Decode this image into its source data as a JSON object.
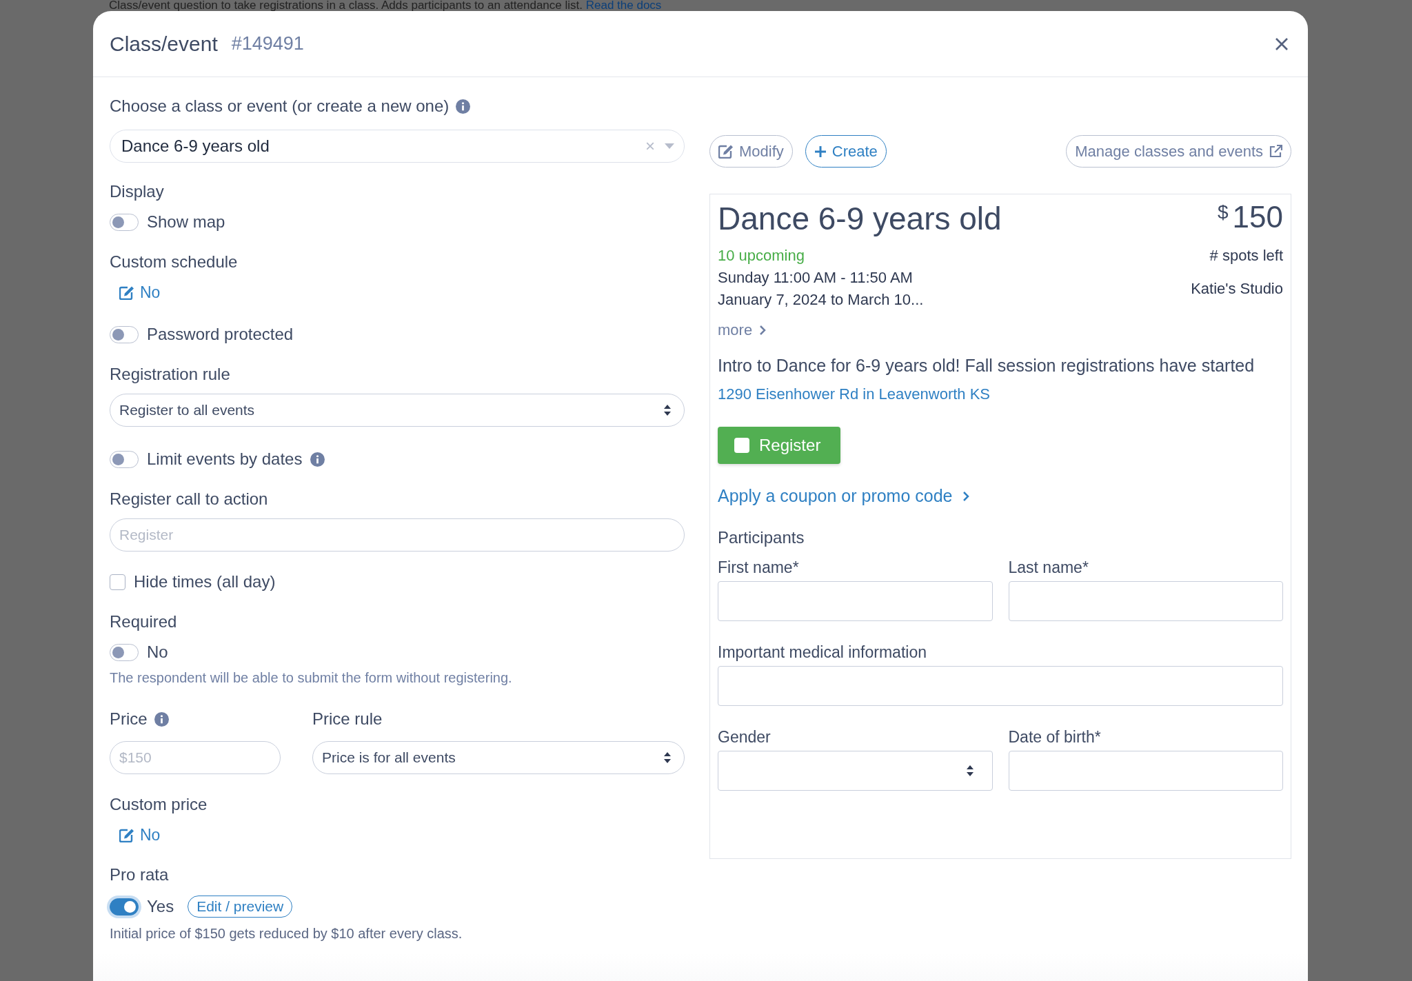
{
  "background": {
    "text": "Class/event question to take registrations in a class. Adds participants to an attendance list.",
    "link": "Read the docs"
  },
  "modal": {
    "title": "Class/event",
    "id": "#149491"
  },
  "chooser": {
    "label": "Choose a class or event (or create a new one)",
    "info": true,
    "value": "Dance 6-9 years old",
    "clear": "×"
  },
  "actions": [
    {
      "label": "Modify"
    },
    {
      "label": "Create"
    }
  ],
  "manage": {
    "label": "Manage classes and events"
  },
  "settings": [
    {
      "kind": "heading",
      "text": "Display"
    },
    {
      "kind": "toggle",
      "label": "Show map",
      "on": false
    },
    {
      "kind": "heading",
      "text": "Custom schedule"
    },
    {
      "kind": "edit_link",
      "text": "No"
    },
    {
      "kind": "toggle",
      "label": "Password protected",
      "on": false
    },
    {
      "kind": "heading",
      "text": "Registration rule"
    },
    {
      "kind": "select",
      "value": "Register to all events"
    },
    {
      "kind": "toggle",
      "label": "Limit events by dates",
      "on": false,
      "info": true
    },
    {
      "kind": "heading",
      "text": "Register call to action"
    },
    {
      "kind": "input",
      "placeholder": "Register"
    },
    {
      "kind": "checkbox",
      "label": "Hide times (all day)",
      "checked": false
    },
    {
      "kind": "heading",
      "text": "Required"
    },
    {
      "kind": "toggle",
      "label": "No",
      "on": false
    },
    {
      "kind": "help",
      "text": "The respondent will be able to submit the form without registering."
    },
    {
      "kind": "price_row",
      "price_label": "Price",
      "info": true,
      "price_placeholder": "$150",
      "rule_label": "Price rule",
      "rule_value": "Price is for all events"
    },
    {
      "kind": "heading",
      "text": "Custom price"
    },
    {
      "kind": "edit_link",
      "text": "No"
    },
    {
      "kind": "heading",
      "text": "Pro rata"
    },
    {
      "kind": "toggle",
      "label": "Yes",
      "on": true,
      "button": "Edit / preview"
    },
    {
      "kind": "help",
      "text": "Initial price of $150 gets reduced by $10 after every class."
    }
  ],
  "preview": {
    "title": "Dance 6-9 years old",
    "currency": "$",
    "price": "150",
    "upcoming": "10 upcoming",
    "spots": "# spots left",
    "schedule": [
      "Sunday 11:00 AM - 11:50 AM",
      "January 7, 2024 to March 10..."
    ],
    "location": "Katie's Studio",
    "more": "more",
    "description": "Intro to Dance for 6-9 years old! Fall session registrations have started",
    "address": "1290 Eisenhower Rd in Leavenworth KS",
    "register": {
      "label": "Register",
      "checked": false
    },
    "coupon": "Apply a coupon or promo code",
    "participants": "Participants",
    "fields": [
      {
        "label": "First name*",
        "kind": "text"
      },
      {
        "label": "Last name*",
        "kind": "text"
      },
      {
        "label": "Important medical information",
        "kind": "long_text"
      },
      {
        "label": "Gender",
        "kind": "select"
      },
      {
        "label": "Date of birth*",
        "kind": "text"
      }
    ]
  }
}
